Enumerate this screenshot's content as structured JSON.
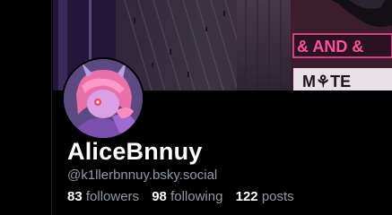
{
  "profile": {
    "display_name": "AliceBnnuy",
    "handle": "@k1llerbnnuy.bsky.social",
    "stats": {
      "followers_count": "83",
      "followers_label": "followers",
      "following_count": "98",
      "following_label": "following",
      "posts_count": "122",
      "posts_label": "posts"
    }
  },
  "banner": {
    "sign_text_1": "& AND &",
    "sign_text_2": "M⚘TE"
  },
  "colors": {
    "background": "#000000",
    "secondary_text": "#8f9aa8",
    "neon_pink": "#ff4fa0"
  }
}
